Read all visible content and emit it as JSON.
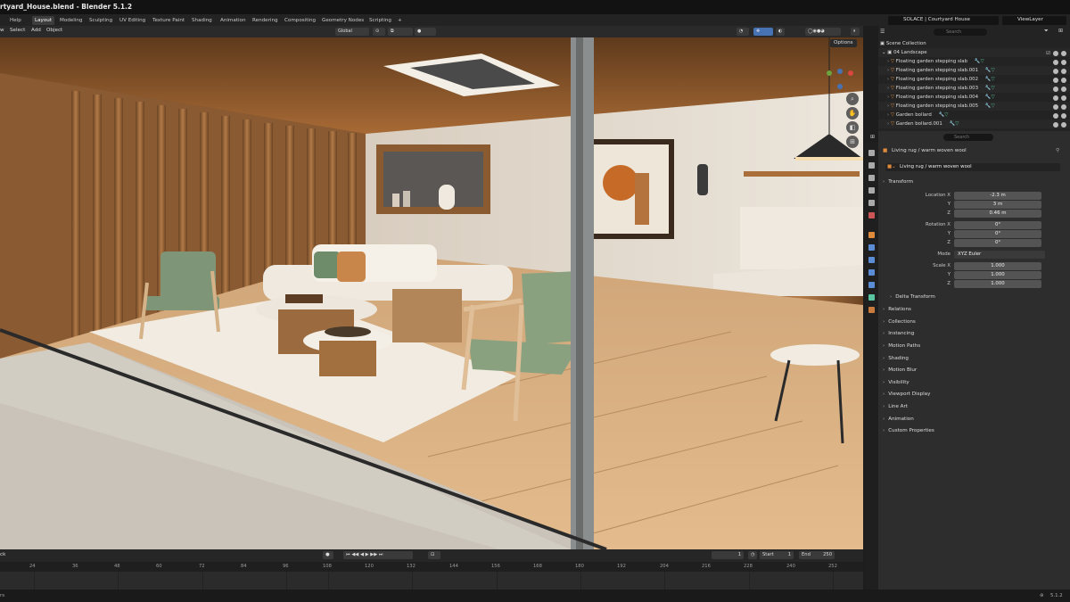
{
  "window": {
    "title": "rtyard_House.blend - Blender 5.1.2"
  },
  "menu": {
    "help": "Help"
  },
  "workspaces": [
    "Layout",
    "Modeling",
    "Sculpting",
    "UV Editing",
    "Texture Paint",
    "Shading",
    "Animation",
    "Rendering",
    "Compositing",
    "Geometry Nodes",
    "Scripting",
    "+"
  ],
  "scene": {
    "name": "SOLACE | Courtyard House",
    "view_layer": "ViewLayer"
  },
  "viewport_menu": {
    "view": "w",
    "select": "Select",
    "add": "Add",
    "object": "Object"
  },
  "viewport": {
    "orientation": "Global",
    "options": "Options"
  },
  "timeline": {
    "frame_label": "ck",
    "current_frame": "1",
    "start_label": "Start",
    "start": "1",
    "end_label": "End",
    "end": "250",
    "ticks": [
      "24",
      "36",
      "48",
      "60",
      "72",
      "84",
      "96",
      "108",
      "120",
      "132",
      "144",
      "156",
      "168",
      "180",
      "192",
      "204",
      "216",
      "228",
      "240",
      "252"
    ]
  },
  "status": {
    "left": "rs",
    "version": "5.1.2"
  },
  "outliner": {
    "search_placeholder": "Search",
    "root": "Scene Collection",
    "collection": "04 Landscape",
    "items": [
      "Floating garden stepping slab",
      "Floating garden stepping slab.001",
      "Floating garden stepping slab.002",
      "Floating garden stepping slab.003",
      "Floating garden stepping slab.004",
      "Floating garden stepping slab.005",
      "Garden bollard",
      "Garden bollard.001"
    ]
  },
  "properties": {
    "search_placeholder": "Search",
    "object_name": "Living rug / warm woven wool",
    "data_name": "Living rug / warm woven wool",
    "transform_label": "Transform",
    "location_label": "Location X",
    "y_label": "Y",
    "z_label": "Z",
    "location": [
      "-2.3 m",
      "3 m",
      "0.46 m"
    ],
    "rotation_label": "Rotation X",
    "rotation": [
      "0°",
      "0°",
      "0°"
    ],
    "mode_label": "Mode",
    "mode": "XYZ Euler",
    "scale_label": "Scale X",
    "scale": [
      "1.000",
      "1.000",
      "1.000"
    ],
    "delta_transform": "Delta Transform",
    "sections": [
      "Relations",
      "Collections",
      "Instancing",
      "Motion Paths",
      "Shading",
      "Motion Blur",
      "Visibility",
      "Viewport Display",
      "Line Art",
      "Animation",
      "Custom Properties"
    ]
  },
  "colors": {
    "accent": "#4772b3",
    "mesh_icon": "#e08b3c",
    "data_icon": "#58c4a0"
  }
}
